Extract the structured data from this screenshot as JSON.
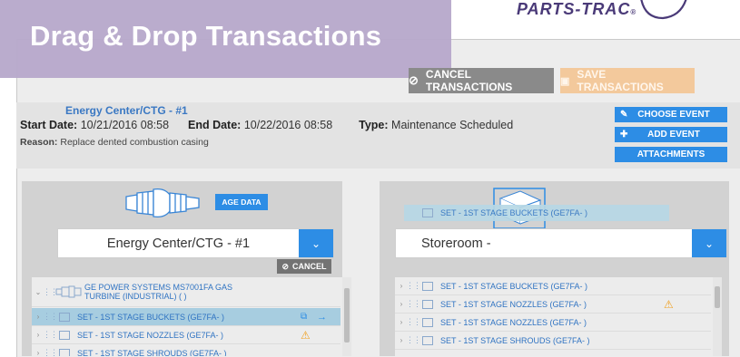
{
  "banner": {
    "title": "Drag & Drop Transactions"
  },
  "logo": {
    "text": "PARTS-TRAC"
  },
  "toolbar": {
    "cancel_label": "CANCEL TRANSACTIONS",
    "save_label": "SAVE TRANSACTIONS"
  },
  "header": {
    "title": "Energy Center/CTG - #1",
    "start_label": "Start Date:",
    "start_value": "10/21/2016 08:58",
    "end_label": "End Date:",
    "end_value": "10/22/2016 08:58",
    "type_label": "Type:",
    "type_value": "Maintenance Scheduled",
    "reason_label": "Reason:",
    "reason_value": "Replace dented combustion casing"
  },
  "side_buttons": {
    "choose_event": "CHOOSE EVENT",
    "add_event": "ADD EVENT",
    "attachments": "ATTACHMENTS"
  },
  "left_panel": {
    "age_data_label": "AGE DATA",
    "select_value": "Energy Center/CTG - #1",
    "cancel_label": "CANCEL",
    "tree_root": "GE POWER SYSTEMS MS7001FA GAS TURBINE (INDUSTRIAL) (        )",
    "items": [
      {
        "label": "SET - 1ST STAGE BUCKETS (GE7FA-        )"
      },
      {
        "label": "SET - 1ST STAGE NOZZLES (GE7FA-        )"
      },
      {
        "label": "SET - 1ST STAGE SHROUDS (GE7FA-        )"
      }
    ]
  },
  "right_panel": {
    "drag_label": "SET - 1ST STAGE BUCKETS (GE7FA-        )",
    "select_value": "Storeroom -",
    "items": [
      {
        "label": "SET - 1ST STAGE BUCKETS (GE7FA-        )"
      },
      {
        "label": "SET - 1ST STAGE NOZZLES (GE7FA-        )"
      },
      {
        "label": "SET - 1ST STAGE NOZZLES (GE7FA-        )"
      },
      {
        "label": "SET - 1ST STAGE SHROUDS (GE7FA-        )"
      }
    ]
  },
  "colors": {
    "accent": "#2d8de5",
    "banner": "#b8a9cc",
    "save_disabled": "#f3c99c",
    "warning": "#f0a020"
  }
}
